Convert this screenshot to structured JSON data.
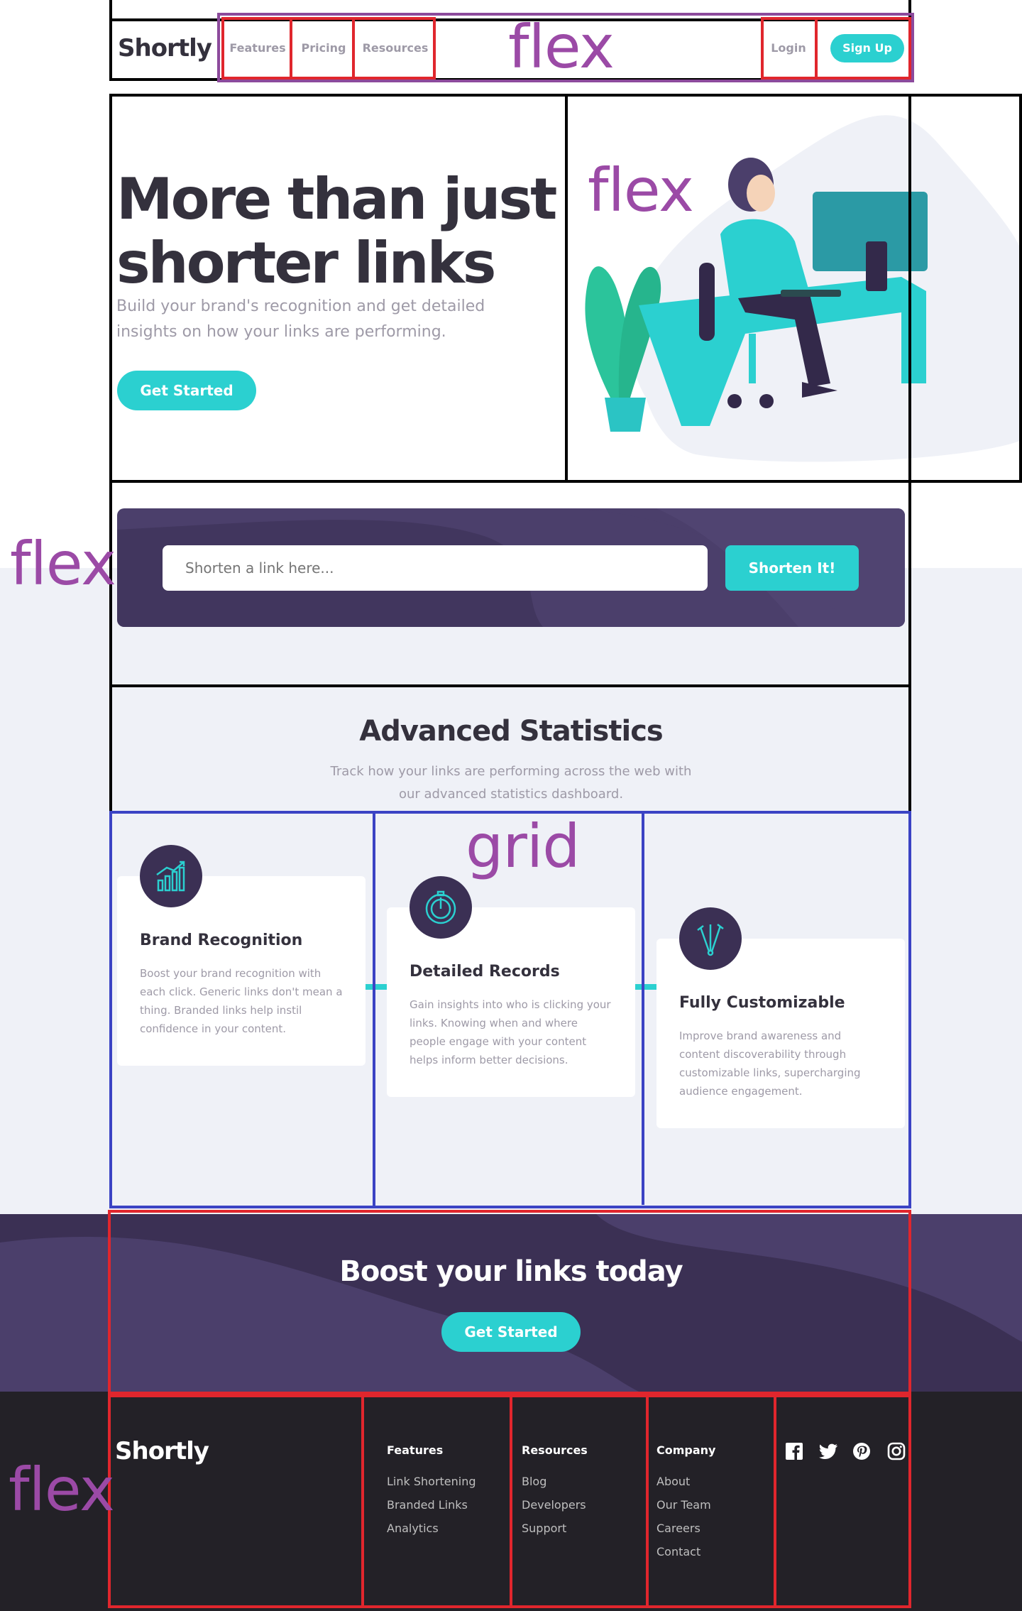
{
  "brand": {
    "logo": "Shortly"
  },
  "nav": {
    "links": [
      "Features",
      "Pricing",
      "Resources"
    ],
    "login": "Login",
    "signup": "Sign Up"
  },
  "hero": {
    "title_line1": "More than just",
    "title_line2": "shorter links",
    "subtitle_line1": "Build your brand's recognition and get detailed",
    "subtitle_line2": "insights on how your links are performing.",
    "cta": "Get Started"
  },
  "shorten": {
    "placeholder": "Shorten a link here...",
    "button": "Shorten It!"
  },
  "stats": {
    "title": "Advanced Statistics",
    "subtitle_line1": "Track how your links are performing across the web with",
    "subtitle_line2": "our advanced statistics dashboard.",
    "cards": [
      {
        "icon": "brand-recognition-icon",
        "title": "Brand Recognition",
        "lines": [
          "Boost your brand recognition with",
          "each click. Generic links don't mean a",
          "thing. Branded links help instil",
          "confidence in your content."
        ]
      },
      {
        "icon": "detailed-records-icon",
        "title": "Detailed Records",
        "lines": [
          "Gain insights into who is clicking your",
          "links. Knowing when and where",
          "people engage with your content",
          "helps inform better decisions."
        ]
      },
      {
        "icon": "fully-customizable-icon",
        "title": "Fully Customizable",
        "lines": [
          "Improve brand awareness and",
          "content discoverability through",
          "customizable links, supercharging",
          "audience engagement."
        ]
      }
    ]
  },
  "boost": {
    "title": "Boost your links today",
    "cta": "Get Started"
  },
  "footer": {
    "logo": "Shortly",
    "columns": [
      {
        "heading": "Features",
        "links": [
          "Link Shortening",
          "Branded Links",
          "Analytics"
        ]
      },
      {
        "heading": "Resources",
        "links": [
          "Blog",
          "Developers",
          "Support"
        ]
      },
      {
        "heading": "Company",
        "links": [
          "About",
          "Our Team",
          "Careers",
          "Contact"
        ]
      }
    ],
    "social": [
      "facebook-icon",
      "twitter-icon",
      "pinterest-icon",
      "instagram-icon"
    ]
  },
  "overlay_labels": {
    "nav": "flex",
    "hero": "flex",
    "shorten": "flex",
    "stats": "grid",
    "footer": "flex"
  },
  "colors": {
    "primary_cyan": "#2bd0d0",
    "dark_violet": "#3b3054",
    "very_dark_violet": "#232127",
    "gray": "#9e9aa7",
    "dark_text": "#34313d",
    "overlay_red": "#e0262d",
    "overlay_blue": "#3b43c4",
    "overlay_purple": "#8c4a9c"
  }
}
